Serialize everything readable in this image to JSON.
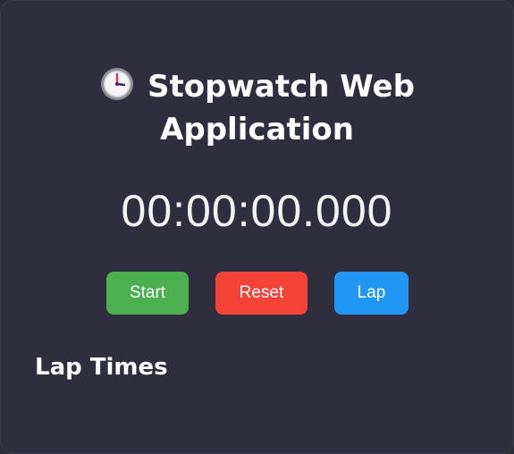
{
  "app": {
    "title": "Stopwatch Web Application",
    "title_icon": "stopwatch-clock-icon"
  },
  "display": {
    "time": "00:00:00.000"
  },
  "controls": {
    "start_label": "Start",
    "reset_label": "Reset",
    "lap_label": "Lap"
  },
  "laps": {
    "heading": "Lap Times",
    "items": []
  },
  "colors": {
    "background": "#2e2e3e",
    "start": "#4caf50",
    "reset": "#f44336",
    "lap": "#2196f3",
    "text": "#ffffff"
  }
}
